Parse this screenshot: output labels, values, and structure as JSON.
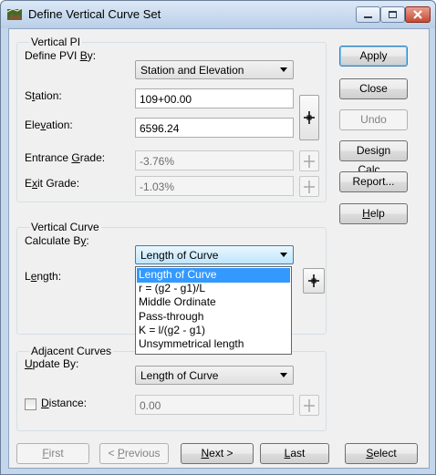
{
  "window": {
    "title": "Define Vertical Curve Set"
  },
  "vertical_pi": {
    "group_title": "Vertical PI",
    "define_by_label": "Define PVI By:",
    "define_by_value": "Station and Elevation",
    "station_label": "Station:",
    "station_value": "109+00.00",
    "elevation_label": "Elevation:",
    "elevation_value": "6596.24",
    "entrance_label": "Entrance Grade:",
    "entrance_value": "-3.76%",
    "exit_label": "Exit Grade:",
    "exit_value": "-1.03%"
  },
  "vertical_curve": {
    "group_title": "Vertical Curve",
    "calculate_by_label": "Calculate By:",
    "calculate_by_value": "Length of Curve",
    "length_label": "Length:",
    "options": [
      "Length of Curve",
      "r = (g2 - g1)/L",
      "Middle Ordinate",
      "Pass-through",
      "K = l/(g2 - g1)",
      "Unsymmetrical length"
    ],
    "selected_option": "Length of Curve"
  },
  "adjacent_curves": {
    "group_title": "Adjacent Curves",
    "update_by_label": "Update By:",
    "update_by_value": "Length of Curve",
    "distance_label": "Distance:",
    "distance_value": "0.00",
    "distance_checked": false
  },
  "side_buttons": {
    "apply": "Apply",
    "close": "Close",
    "undo": "Undo",
    "design_calc": "Design Calc...",
    "report": "Report...",
    "help": "Help"
  },
  "nav_buttons": {
    "first": "First",
    "previous": "< Previous",
    "next": "Next >",
    "last": "Last",
    "select": "Select"
  }
}
